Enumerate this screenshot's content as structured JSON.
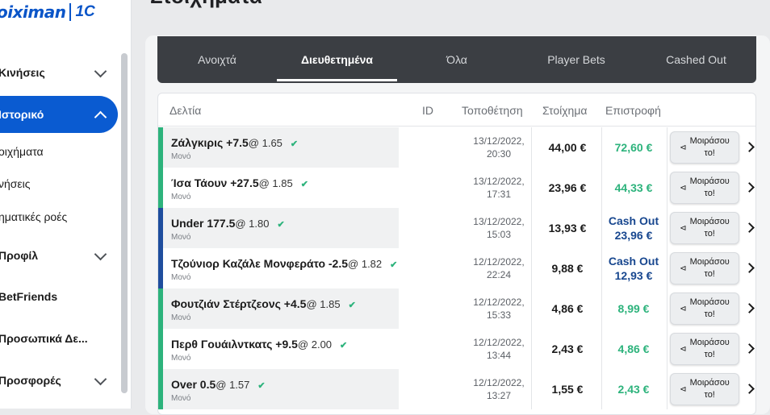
{
  "brand": {
    "logo_text": "oiximan",
    "badge": "1C"
  },
  "page": {
    "title": "Στοιχήματα"
  },
  "sidebar": {
    "items": [
      {
        "label": "Κινήσεις",
        "chevron": "down"
      },
      {
        "label": "Ιστορικό",
        "chevron": "up",
        "active": true
      },
      {
        "label": "Προφίλ",
        "chevron": "down"
      },
      {
        "label": "BetFriends"
      },
      {
        "label": "Προσωπικά Δε..."
      },
      {
        "label": "Προσφορές",
        "chevron": "down"
      }
    ],
    "sub_items": [
      {
        "label": "οιχήματα"
      },
      {
        "label": "νήσεις"
      },
      {
        "label": "ηματικές ροές"
      }
    ]
  },
  "tabs": [
    {
      "label": "Ανοιχτά"
    },
    {
      "label": "Διευθετημένα",
      "active": true
    },
    {
      "label": "Όλα"
    },
    {
      "label": "Player Bets"
    },
    {
      "label": "Cashed Out"
    }
  ],
  "table": {
    "headers": {
      "slips": "Δελτία",
      "id": "ID",
      "placement": "Τοποθέτηση",
      "stake": "Στοίχημα",
      "return": "Επιστροφή"
    },
    "share_label_1": "Μοιράσου",
    "share_label_2": "το!",
    "rows": [
      {
        "selection": "Ζάλγκιρις +7.5",
        "odds": "@ 1.65",
        "type": "Μονό",
        "date": "13/12/2022,",
        "time": "20:30",
        "stake": "44,00 €",
        "return": "72,60 €",
        "cash_out": false,
        "bar_color": "#2db37c"
      },
      {
        "selection": "Ίσα Τάουν +27.5",
        "odds": "@ 1.85",
        "type": "Μονό",
        "date": "13/12/2022,",
        "time": "17:31",
        "stake": "23,96 €",
        "return": "44,33 €",
        "cash_out": false,
        "bar_color": "#2db37c"
      },
      {
        "selection": "Under 177.5",
        "odds": "@ 1.80",
        "type": "Μονό",
        "date": "13/12/2022,",
        "time": "15:03",
        "stake": "13,93 €",
        "return_label": "Cash Out",
        "return": "23,96 €",
        "cash_out": true,
        "bar_color": "#1f4e9e"
      },
      {
        "selection": "Τζούνιορ Καζάλε Μονφεράτο -2.5",
        "odds": "@ 1.82",
        "type": "Μονό",
        "date": "12/12/2022,",
        "time": "22:24",
        "stake": "9,88 €",
        "return_label": "Cash Out",
        "return": "12,93 €",
        "cash_out": true,
        "bar_color": "#1f4e9e"
      },
      {
        "selection": "Φουτζιάν Στέρτζεονς +4.5",
        "odds": "@ 1.85",
        "type": "Μονό",
        "date": "12/12/2022,",
        "time": "15:33",
        "stake": "4,86 €",
        "return": "8,99 €",
        "cash_out": false,
        "bar_color": "#2db37c"
      },
      {
        "selection": "Περθ Γουάιλντκατς +9.5",
        "odds": "@ 2.00",
        "type": "Μονό",
        "date": "12/12/2022,",
        "time": "13:44",
        "stake": "2,43 €",
        "return": "4,86 €",
        "cash_out": false,
        "bar_color": "#2db37c"
      },
      {
        "selection": "Over 0.5",
        "odds": "@ 1.57",
        "type": "Μονό",
        "date": "12/12/2022,",
        "time": "13:27",
        "stake": "1,55 €",
        "return": "2,43 €",
        "cash_out": false,
        "bar_color": "#2db37c"
      }
    ]
  },
  "icons": {
    "share": "share-icon",
    "row_arrow": "chevron-right-icon",
    "check": "check-icon",
    "nav_chevron": "chevron-icon"
  }
}
